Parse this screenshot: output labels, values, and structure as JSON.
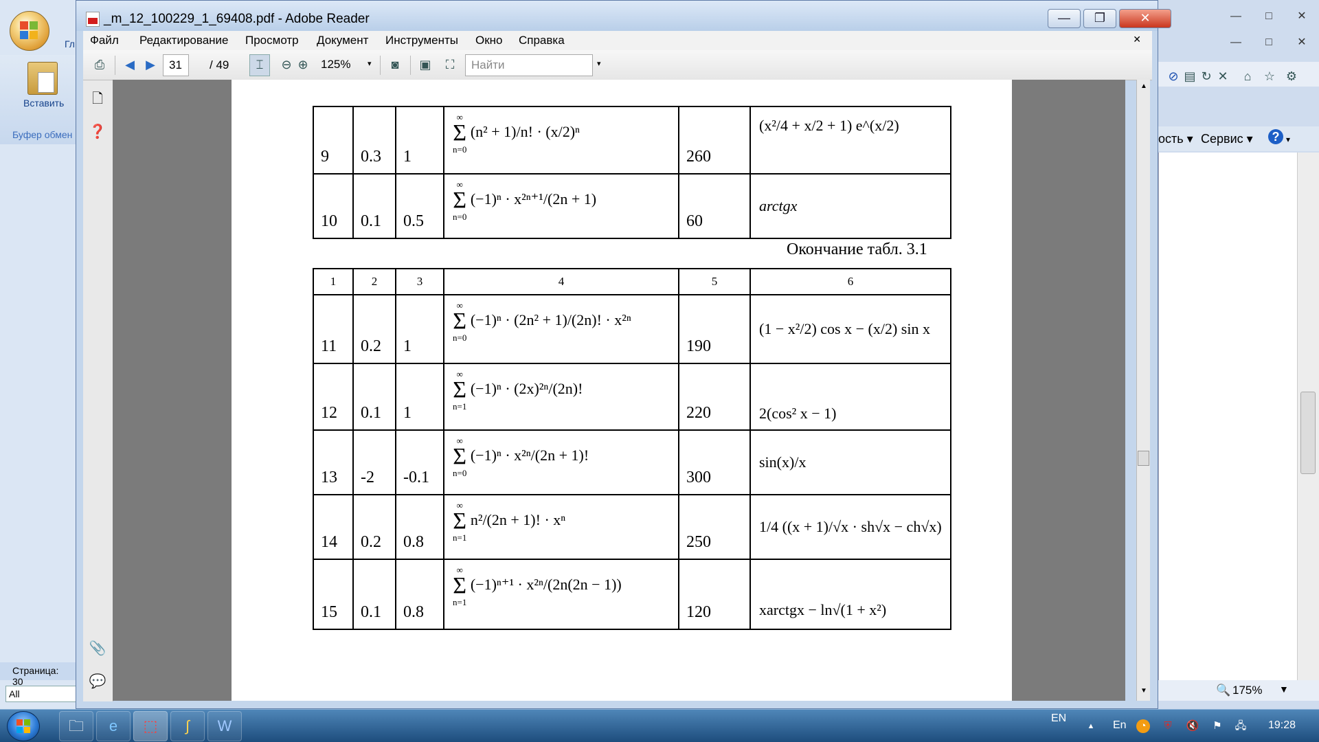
{
  "background_word": {
    "tab_partial": "Гл",
    "paste_label": "Вставить",
    "clipboard_label": "Буфер обмен",
    "status_text": "Страница: 30",
    "style_box": "All"
  },
  "background_ie": {
    "cmd_partial": "ость",
    "service_label": "Сервис",
    "help_icon": "?",
    "zoom": "175%"
  },
  "reader": {
    "title": "_m_12_100229_1_69408.pdf - Adobe Reader",
    "menu": [
      "Файл",
      "Редактирование",
      "Просмотр",
      "Документ",
      "Инструменты",
      "Окно",
      "Справка"
    ],
    "page_current": "31",
    "page_total": "/ 49",
    "zoom": "125%",
    "search_placeholder": "Найти"
  },
  "document": {
    "caption": "Окончание табл. 3.1",
    "header": [
      "1",
      "2",
      "3",
      "4",
      "5",
      "6"
    ],
    "rows_top": [
      {
        "n": "9",
        "a": "0.3",
        "b": "1",
        "sum_top": "∞",
        "sum_bottom": "n=0",
        "term": "(n² + 1)/n! · (x/2)ⁿ",
        "k": "260",
        "func": "(x²/4 + x/2 + 1) e^(x/2)"
      },
      {
        "n": "10",
        "a": "0.1",
        "b": "0.5",
        "sum_top": "∞",
        "sum_bottom": "n=0",
        "term": "(−1)ⁿ · x²ⁿ⁺¹/(2n + 1)",
        "k": "60",
        "func": "arctgx"
      }
    ],
    "rows": [
      {
        "n": "11",
        "a": "0.2",
        "b": "1",
        "sum_top": "∞",
        "sum_bottom": "n=0",
        "term": "(−1)ⁿ · (2n² + 1)/(2n)! · x²ⁿ",
        "k": "190",
        "func": "(1 − x²/2) cos x − (x/2) sin x"
      },
      {
        "n": "12",
        "a": "0.1",
        "b": "1",
        "sum_top": "∞",
        "sum_bottom": "n=1",
        "term": "(−1)ⁿ · (2x)²ⁿ/(2n)!",
        "k": "220",
        "func": "2(cos² x − 1)"
      },
      {
        "n": "13",
        "a": "-2",
        "b": "-0.1",
        "sum_top": "∞",
        "sum_bottom": "n=0",
        "term": "(−1)ⁿ · x²ⁿ/(2n + 1)!",
        "k": "300",
        "func": "sin(x)/x"
      },
      {
        "n": "14",
        "a": "0.2",
        "b": "0.8",
        "sum_top": "∞",
        "sum_bottom": "n=1",
        "term": "n²/(2n + 1)! · xⁿ",
        "k": "250",
        "func": "1/4 ((x + 1)/√x · sh√x − ch√x)"
      },
      {
        "n": "15",
        "a": "0.1",
        "b": "0.8",
        "sum_top": "∞",
        "sum_bottom": "n=1",
        "term": "(−1)ⁿ⁺¹ · x²ⁿ/(2n(2n − 1))",
        "k": "120",
        "func": "xarctgx − ln√(1 + x²)"
      }
    ]
  },
  "taskbar": {
    "lang": "EN",
    "lang2": "En",
    "time": "19:28"
  }
}
